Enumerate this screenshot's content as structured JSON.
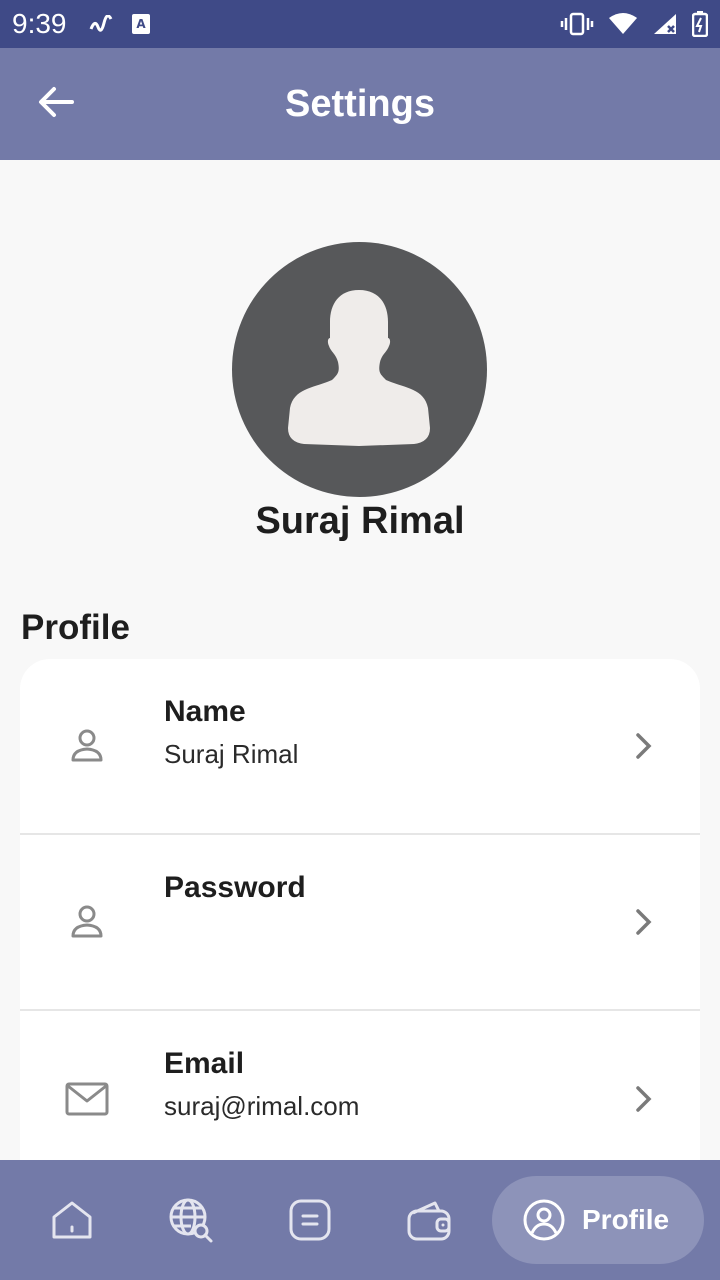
{
  "status_bar": {
    "time": "9:39"
  },
  "app_bar": {
    "title": "Settings"
  },
  "profile_header": {
    "name": "Suraj Rimal"
  },
  "section": {
    "title": "Profile"
  },
  "settings_rows": [
    {
      "label": "Name",
      "value": "Suraj Rimal",
      "icon": "user-icon"
    },
    {
      "label": "Password",
      "value": "",
      "icon": "user-icon"
    },
    {
      "label": "Email",
      "value": "suraj@rimal.com",
      "icon": "mail-icon"
    }
  ],
  "bottom_nav": {
    "items": [
      {
        "icon": "home-icon"
      },
      {
        "icon": "globe-search-icon"
      },
      {
        "icon": "document-icon"
      },
      {
        "icon": "wallet-icon"
      }
    ],
    "active_label": "Profile",
    "active_icon": "profile-icon"
  },
  "colors": {
    "status_bar": "#3f4a87",
    "app_bar": "#737aa8",
    "active_pill": "#8d93b9",
    "avatar_bg": "#57585a"
  }
}
